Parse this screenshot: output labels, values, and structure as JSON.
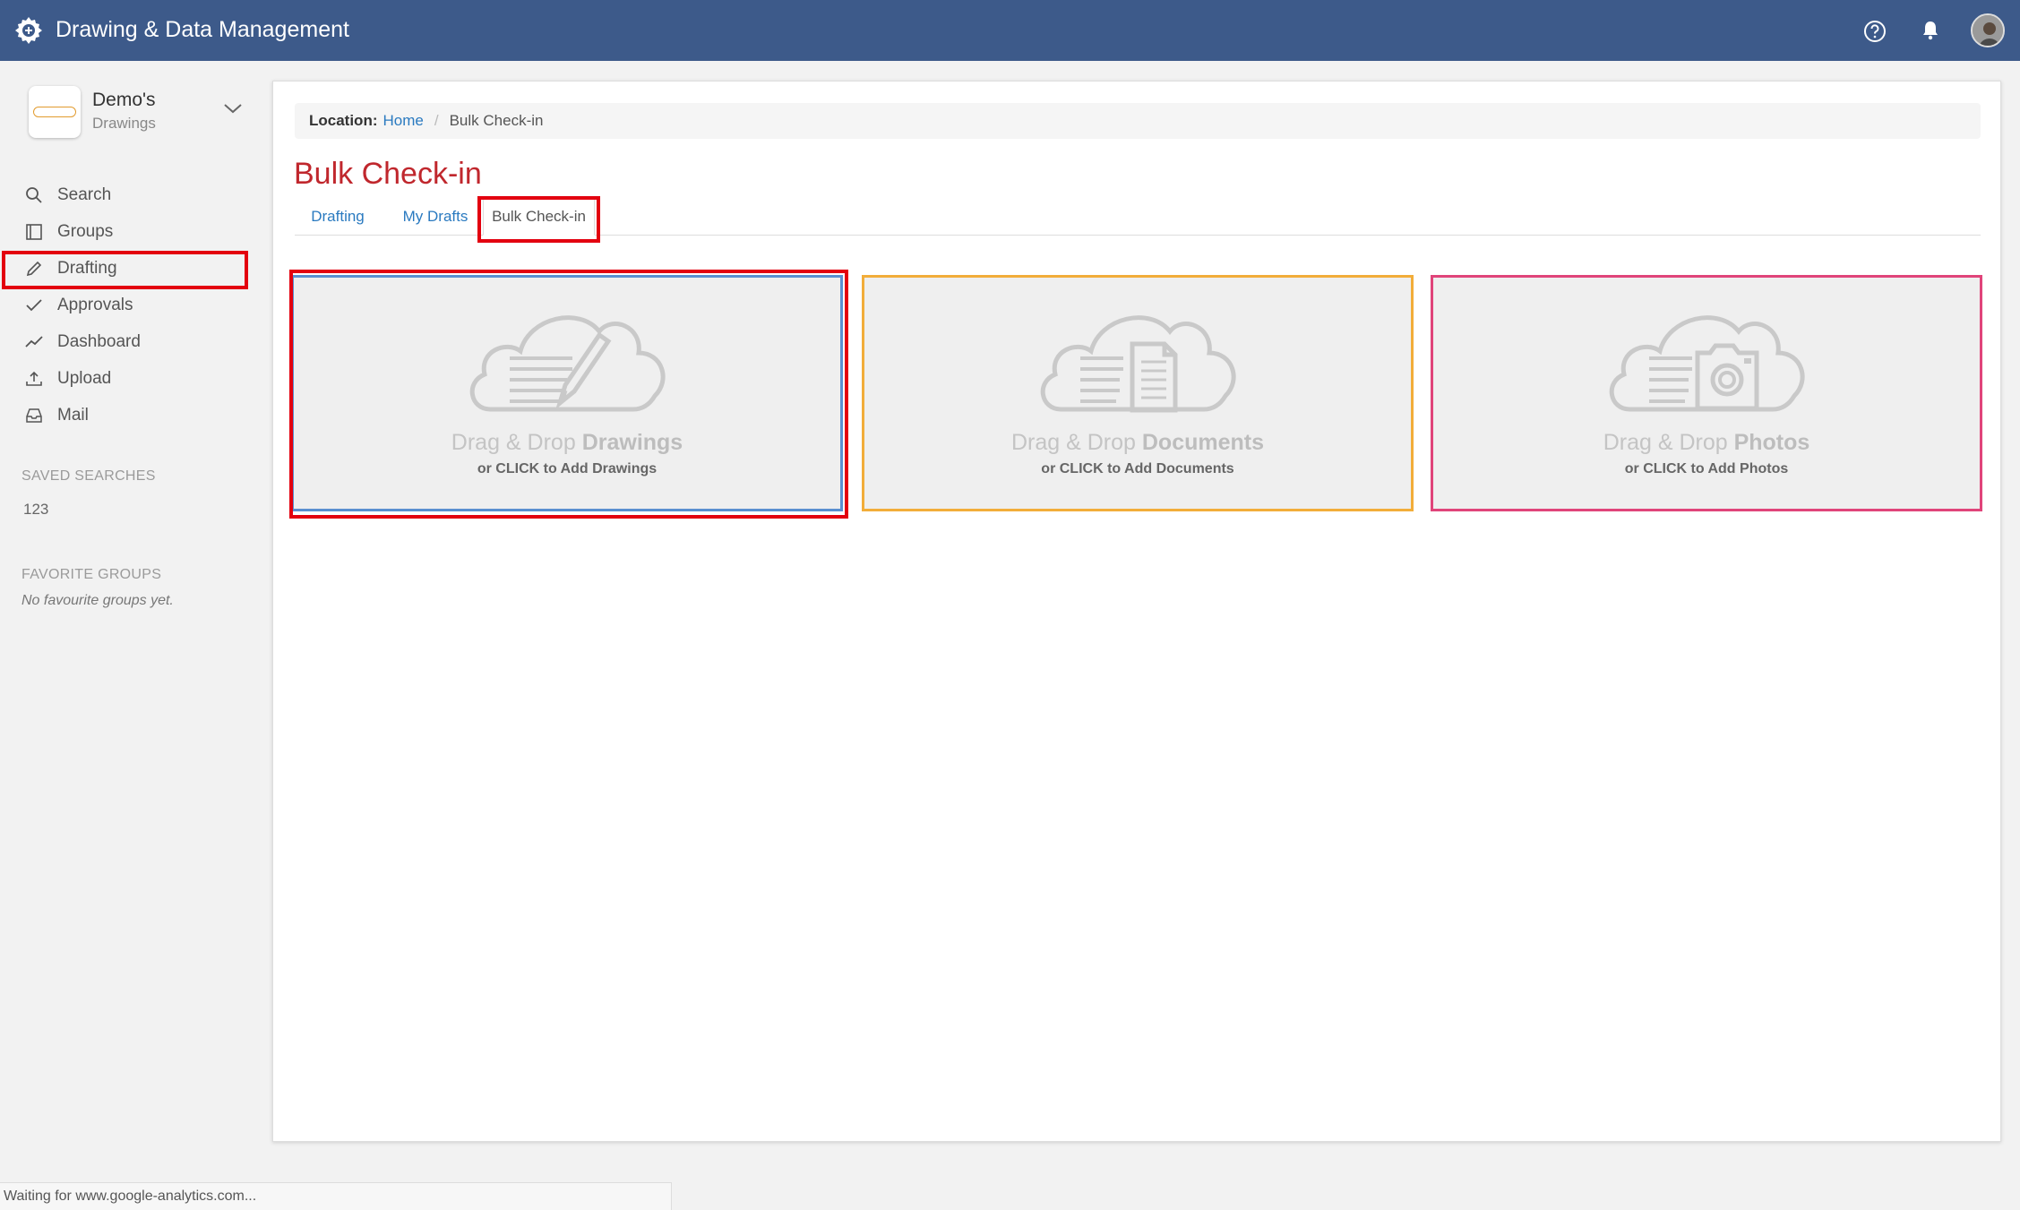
{
  "header": {
    "app_title": "Drawing & Data Management",
    "icons": [
      "gear-logo-icon",
      "help-icon",
      "bell-icon",
      "user-avatar"
    ],
    "bg_color": "#3d5a8a"
  },
  "sidebar": {
    "org_name": "Demo's",
    "org_sub": "Drawings",
    "items": [
      {
        "label": "Search",
        "icon": "search-icon"
      },
      {
        "label": "Groups",
        "icon": "book-icon"
      },
      {
        "label": "Drafting",
        "icon": "pencil-icon"
      },
      {
        "label": "Approvals",
        "icon": "check-icon"
      },
      {
        "label": "Dashboard",
        "icon": "line-chart-icon"
      },
      {
        "label": "Upload",
        "icon": "upload-icon"
      },
      {
        "label": "Mail",
        "icon": "inbox-icon"
      }
    ],
    "saved_searches_title": "SAVED SEARCHES",
    "saved_searches": [
      "123"
    ],
    "favorite_groups_title": "FAVORITE GROUPS",
    "favorite_groups_empty": "No favourite groups yet."
  },
  "main": {
    "breadcrumb": {
      "label": "Location:",
      "home": "Home",
      "current": "Bulk Check-in"
    },
    "page_title": "Bulk Check-in",
    "tabs": [
      {
        "label": "Drafting",
        "active": false
      },
      {
        "label": "My Drafts",
        "active": false
      },
      {
        "label": "Bulk Check-in",
        "active": true
      }
    ],
    "dropzones": [
      {
        "prefix": "Drag & Drop",
        "bold": "Drawings",
        "sub": "or CLICK to Add Drawings",
        "color": "#5a8fd0",
        "icon": "cloud-pencil-icon"
      },
      {
        "prefix": "Drag & Drop",
        "bold": "Documents",
        "sub": "or CLICK to Add Documents",
        "color": "#f2ad3a",
        "icon": "cloud-document-icon"
      },
      {
        "prefix": "Drag & Drop",
        "bold": "Photos",
        "sub": "or CLICK to Add Photos",
        "color": "#e0447a",
        "icon": "cloud-camera-icon"
      }
    ]
  },
  "status_bar": {
    "text": "Waiting for www.google-analytics.com..."
  },
  "colors": {
    "accent_red": "#c0272d",
    "link_blue": "#2a7ac0",
    "annotation_red": "#e3000f"
  }
}
